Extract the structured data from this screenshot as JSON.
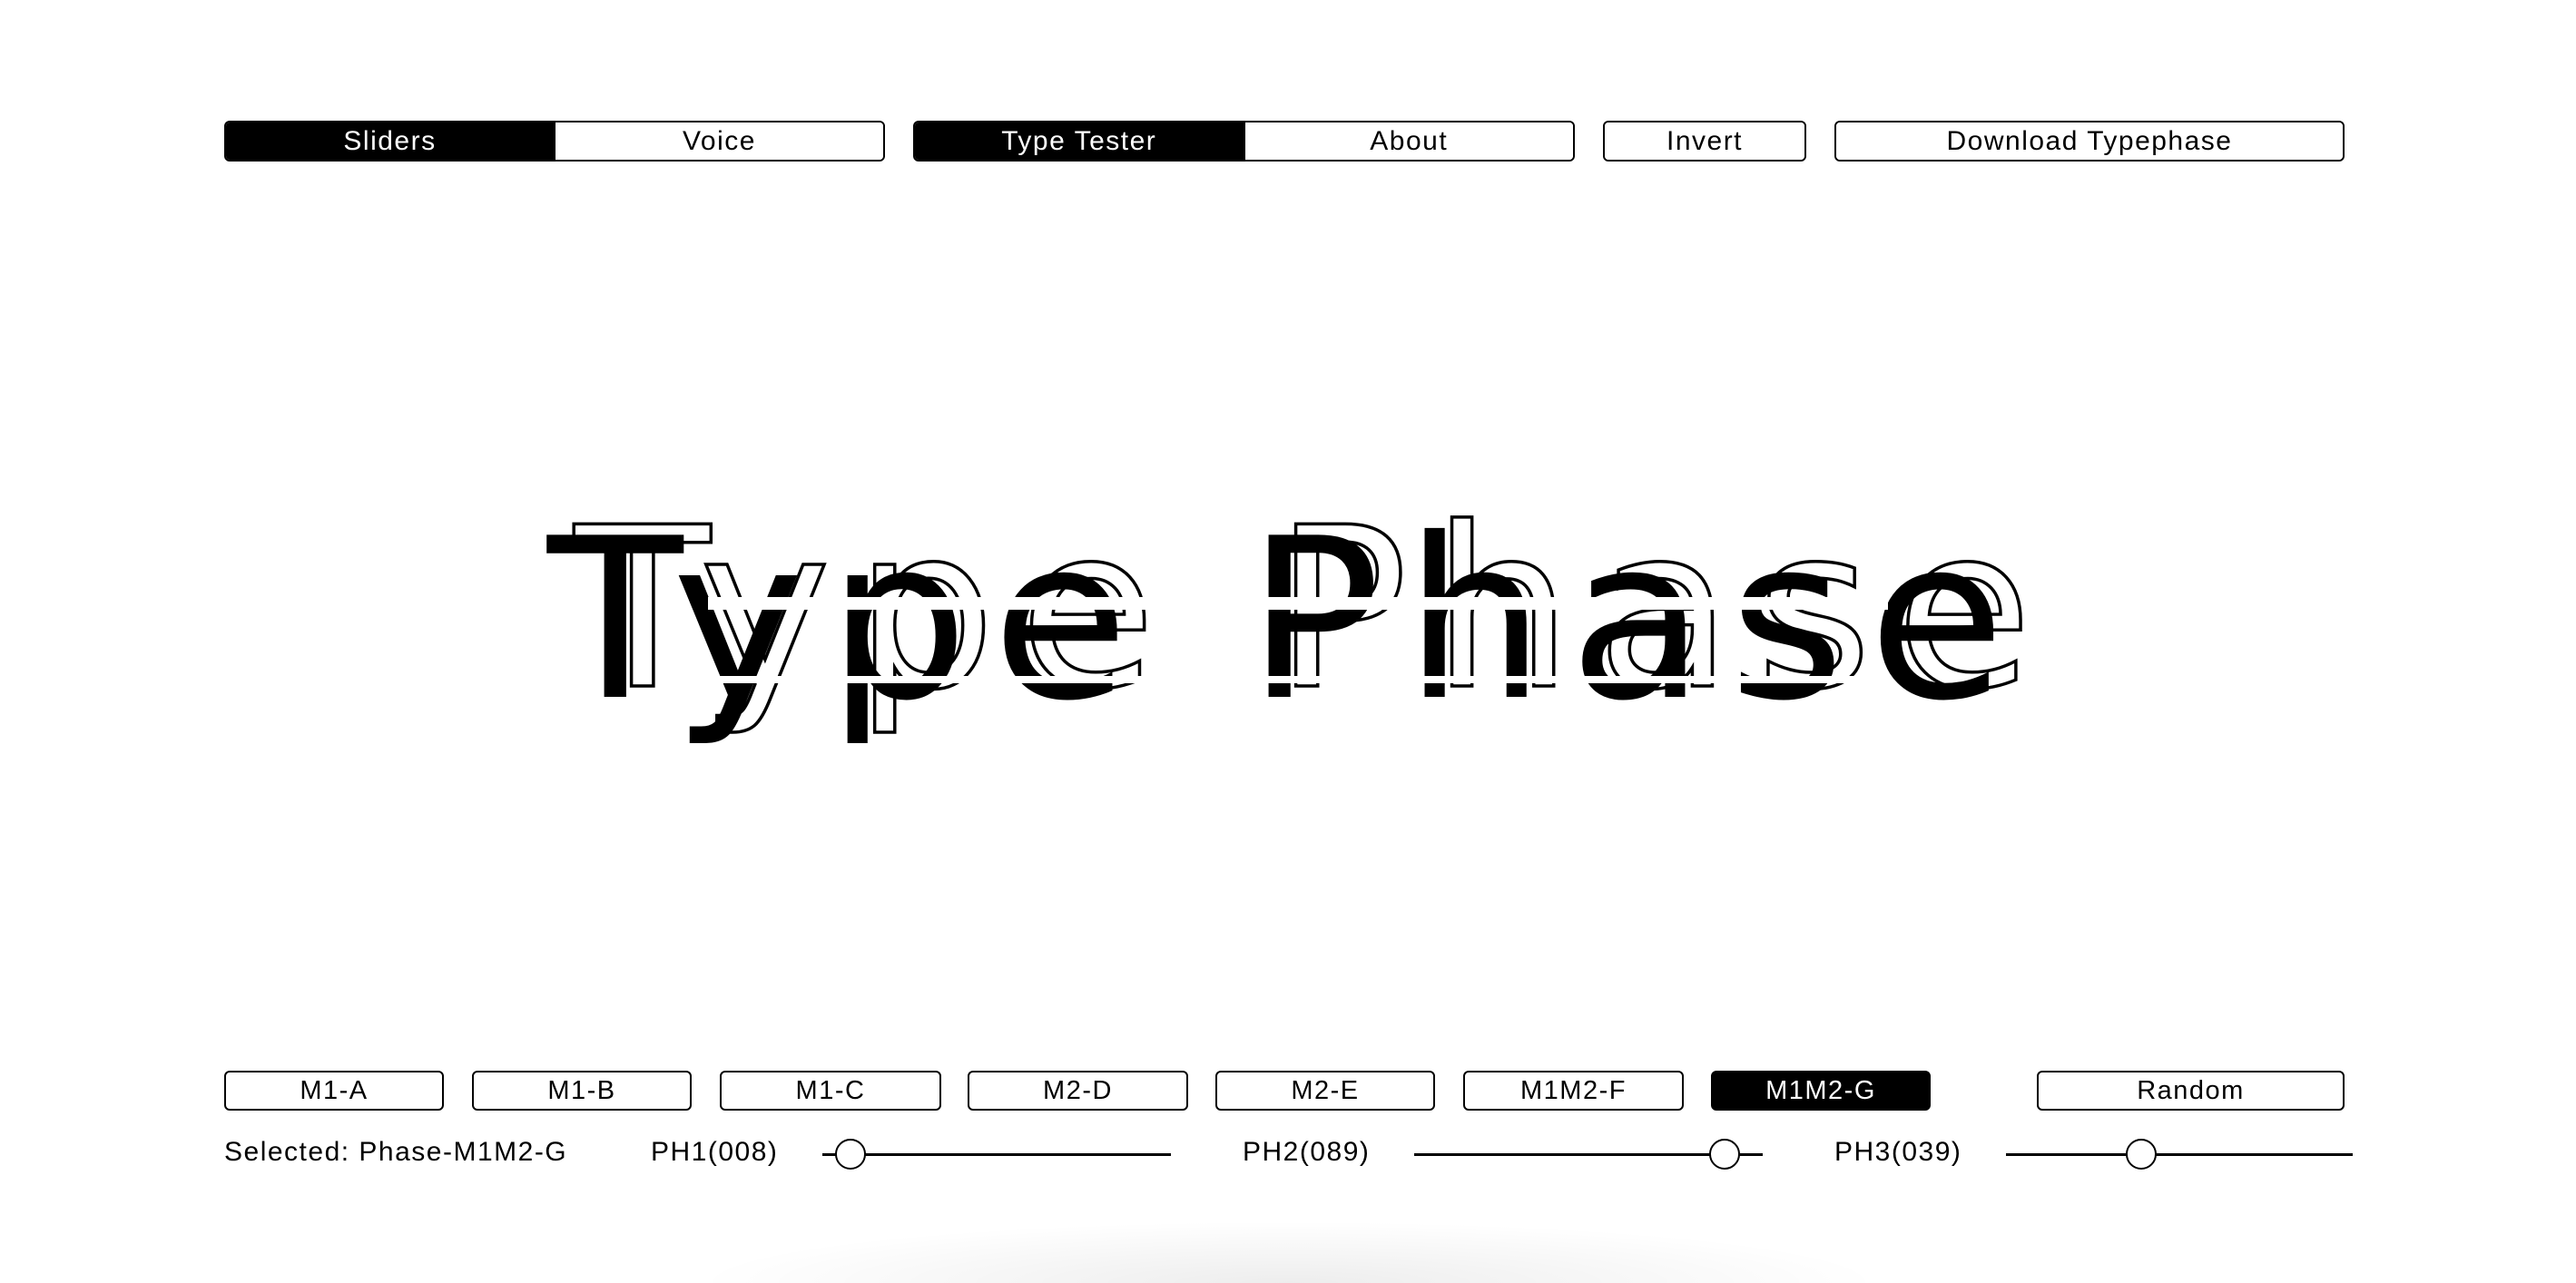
{
  "nav": {
    "mode_tabs": [
      {
        "label": "Sliders",
        "active": true
      },
      {
        "label": "Voice",
        "active": false
      }
    ],
    "page_tabs": [
      {
        "label": "Type Tester",
        "active": true
      },
      {
        "label": "About",
        "active": false
      }
    ],
    "invert_label": "Invert",
    "download_label": "Download Typephase"
  },
  "hero": {
    "text": "Type Phase"
  },
  "presets": [
    {
      "label": "M1-A",
      "active": false
    },
    {
      "label": "M1-B",
      "active": false
    },
    {
      "label": "M1-C",
      "active": false
    },
    {
      "label": "M2-D",
      "active": false
    },
    {
      "label": "M2-E",
      "active": false
    },
    {
      "label": "M1M2-F",
      "active": false
    },
    {
      "label": "M1M2-G",
      "active": true
    }
  ],
  "random_label": "Random",
  "status": {
    "selected_text": "Selected: Phase-M1M2-G"
  },
  "sliders": [
    {
      "label": "PH1(008)",
      "value": 8,
      "max": 100
    },
    {
      "label": "PH2(089)",
      "value": 89,
      "max": 100
    },
    {
      "label": "PH3(039)",
      "value": 39,
      "max": 100
    }
  ],
  "colors": {
    "foreground": "#000000",
    "background": "#ffffff"
  }
}
